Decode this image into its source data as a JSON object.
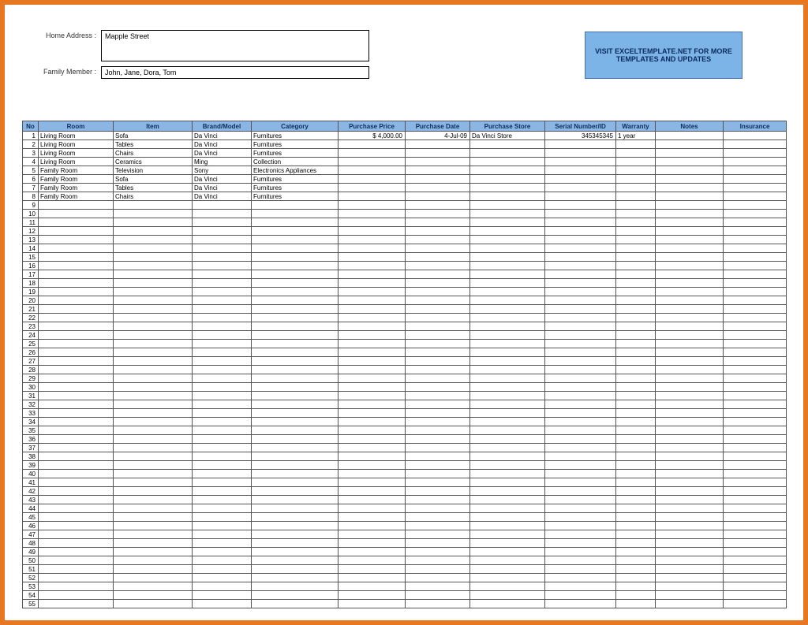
{
  "form": {
    "home_address_label": "Home Address :",
    "home_address_value": "Mapple Street",
    "family_member_label": "Family Member :",
    "family_member_value": "John, Jane, Dora, Tom"
  },
  "promo": {
    "text": "VISIT EXCELTEMPLATE.NET FOR MORE TEMPLATES AND UPDATES"
  },
  "grid": {
    "headers": {
      "no": "No",
      "room": "Room",
      "item": "Item",
      "brand": "Brand/Model",
      "category": "Category",
      "price": "Purchase Price",
      "date": "Purchase Date",
      "store": "Purchase Store",
      "serial": "Serial Number/ID",
      "warranty": "Warranty",
      "notes": "Notes",
      "insurance": "Insurance"
    },
    "rows": [
      {
        "no": "1",
        "room": "Living Room",
        "item": "Sofa",
        "brand": "Da Vinci",
        "category": "Furnitures",
        "price": "$        4,000.00",
        "date": "4-Jul-09",
        "store": "Da Vinci Store",
        "serial": "345345345",
        "warranty": "1 year",
        "notes": "",
        "insurance": ""
      },
      {
        "no": "2",
        "room": "Living Room",
        "item": "Tables",
        "brand": "Da Vinci",
        "category": "Furnitures",
        "price": "",
        "date": "",
        "store": "",
        "serial": "",
        "warranty": "",
        "notes": "",
        "insurance": ""
      },
      {
        "no": "3",
        "room": "Living Room",
        "item": "Chairs",
        "brand": "Da Vinci",
        "category": "Furnitures",
        "price": "",
        "date": "",
        "store": "",
        "serial": "",
        "warranty": "",
        "notes": "",
        "insurance": ""
      },
      {
        "no": "4",
        "room": "Living Room",
        "item": "Ceramics",
        "brand": "Ming",
        "category": "Collection",
        "price": "",
        "date": "",
        "store": "",
        "serial": "",
        "warranty": "",
        "notes": "",
        "insurance": ""
      },
      {
        "no": "5",
        "room": "Family Room",
        "item": "Television",
        "brand": "Sony",
        "category": "Electronics Appliances",
        "price": "",
        "date": "",
        "store": "",
        "serial": "",
        "warranty": "",
        "notes": "",
        "insurance": ""
      },
      {
        "no": "6",
        "room": "Family Room",
        "item": "Sofa",
        "brand": "Da Vinci",
        "category": "Furnitures",
        "price": "",
        "date": "",
        "store": "",
        "serial": "",
        "warranty": "",
        "notes": "",
        "insurance": ""
      },
      {
        "no": "7",
        "room": "Family Room",
        "item": "Tables",
        "brand": "Da Vinci",
        "category": "Furnitures",
        "price": "",
        "date": "",
        "store": "",
        "serial": "",
        "warranty": "",
        "notes": "",
        "insurance": ""
      },
      {
        "no": "8",
        "room": "Family Room",
        "item": "Chairs",
        "brand": "Da Vinci",
        "category": "Furnitures",
        "price": "",
        "date": "",
        "store": "",
        "serial": "",
        "warranty": "",
        "notes": "",
        "insurance": ""
      }
    ],
    "total_rows": 55
  }
}
